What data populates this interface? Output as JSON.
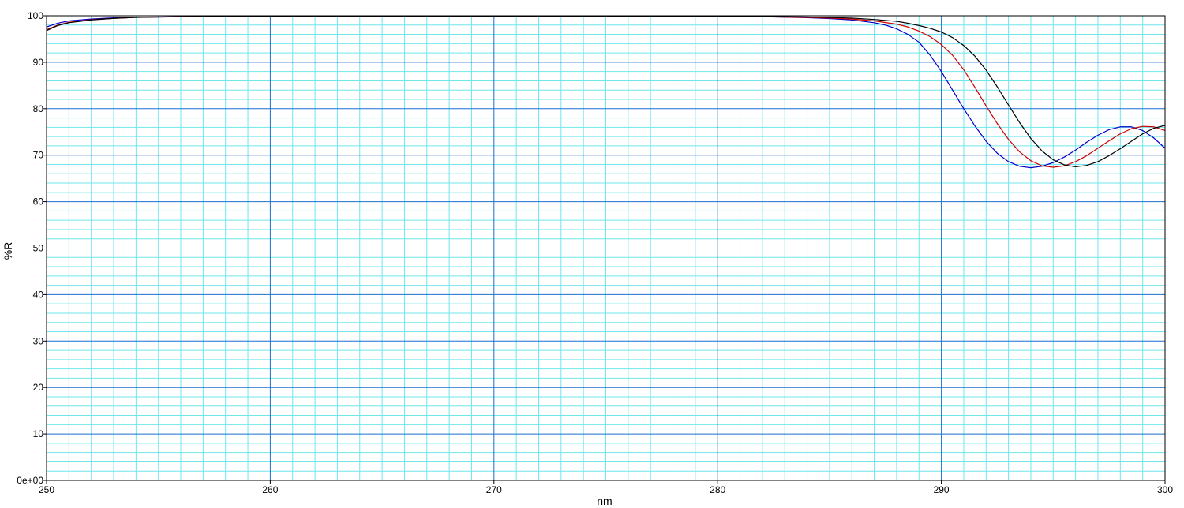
{
  "chart_data": {
    "type": "line",
    "title": "",
    "xlabel": "nm",
    "ylabel": "%R",
    "xlim": [
      250,
      300
    ],
    "ylim": [
      0,
      100
    ],
    "grid": true,
    "x_major_ticks": [
      "250",
      "260",
      "270",
      "280",
      "290",
      "300"
    ],
    "y_major_ticks": [
      "0e+00",
      "10",
      "20",
      "30",
      "40",
      "50",
      "60",
      "70",
      "80",
      "90",
      "100"
    ],
    "colors": {
      "major_grid": "#1a6fd0",
      "minor_grid": "#6fe6ee",
      "frame": "#000000",
      "series": [
        "#0000cc",
        "#cc0000",
        "#000000"
      ]
    },
    "series": [
      {
        "color": "#0000cc",
        "points": [
          [
            250,
            97.6
          ],
          [
            250.5,
            98.4
          ],
          [
            251,
            98.9
          ],
          [
            252,
            99.3
          ],
          [
            253,
            99.55
          ],
          [
            254,
            99.7
          ],
          [
            256,
            99.8
          ],
          [
            260,
            99.85
          ],
          [
            270,
            99.9
          ],
          [
            280,
            99.9
          ],
          [
            282,
            99.8
          ],
          [
            284,
            99.6
          ],
          [
            285,
            99.4
          ],
          [
            286,
            99.1
          ],
          [
            287,
            98.5
          ],
          [
            287.5,
            98
          ],
          [
            288,
            97.2
          ],
          [
            288.5,
            96
          ],
          [
            289,
            94.3
          ],
          [
            289.5,
            91.5
          ],
          [
            290,
            88
          ],
          [
            290.5,
            84
          ],
          [
            291,
            80
          ],
          [
            291.5,
            76.3
          ],
          [
            292,
            73
          ],
          [
            292.5,
            70.4
          ],
          [
            293,
            68.6
          ],
          [
            293.5,
            67.6
          ],
          [
            294,
            67.3
          ],
          [
            294.5,
            67.6
          ],
          [
            295,
            68.4
          ],
          [
            295.5,
            69.6
          ],
          [
            296,
            71.1
          ],
          [
            296.5,
            72.8
          ],
          [
            297,
            74.3
          ],
          [
            297.5,
            75.5
          ],
          [
            298,
            76.1
          ],
          [
            298.5,
            76.1
          ],
          [
            299,
            75.3
          ],
          [
            299.5,
            73.7
          ],
          [
            300,
            71.5
          ]
        ]
      },
      {
        "color": "#cc0000",
        "points": [
          [
            250,
            97
          ],
          [
            250.5,
            98
          ],
          [
            251,
            98.6
          ],
          [
            252,
            99.15
          ],
          [
            253,
            99.45
          ],
          [
            254,
            99.65
          ],
          [
            256,
            99.8
          ],
          [
            260,
            99.85
          ],
          [
            270,
            99.9
          ],
          [
            280,
            99.9
          ],
          [
            282,
            99.8
          ],
          [
            284,
            99.65
          ],
          [
            285,
            99.5
          ],
          [
            286,
            99.3
          ],
          [
            287,
            98.9
          ],
          [
            288,
            98.2
          ],
          [
            288.5,
            97.6
          ],
          [
            289,
            96.7
          ],
          [
            289.5,
            95.5
          ],
          [
            290,
            93.8
          ],
          [
            290.5,
            91.5
          ],
          [
            291,
            88.4
          ],
          [
            291.5,
            84.6
          ],
          [
            292,
            80.6
          ],
          [
            292.5,
            76.8
          ],
          [
            293,
            73.4
          ],
          [
            293.5,
            70.7
          ],
          [
            294,
            68.8
          ],
          [
            294.5,
            67.7
          ],
          [
            295,
            67.4
          ],
          [
            295.5,
            67.7
          ],
          [
            296,
            68.6
          ],
          [
            296.5,
            69.9
          ],
          [
            297,
            71.5
          ],
          [
            297.5,
            73.1
          ],
          [
            298,
            74.6
          ],
          [
            298.5,
            75.7
          ],
          [
            299,
            76.2
          ],
          [
            299.5,
            76.1
          ],
          [
            300,
            75.3
          ]
        ]
      },
      {
        "color": "#000000",
        "points": [
          [
            250,
            96.8
          ],
          [
            250.5,
            97.9
          ],
          [
            251,
            98.5
          ],
          [
            252,
            99.1
          ],
          [
            253,
            99.45
          ],
          [
            254,
            99.65
          ],
          [
            256,
            99.8
          ],
          [
            260,
            99.85
          ],
          [
            270,
            99.9
          ],
          [
            280,
            99.9
          ],
          [
            282,
            99.85
          ],
          [
            284,
            99.75
          ],
          [
            285,
            99.65
          ],
          [
            286,
            99.5
          ],
          [
            287,
            99.2
          ],
          [
            288,
            98.8
          ],
          [
            288.5,
            98.4
          ],
          [
            289,
            97.9
          ],
          [
            289.5,
            97.3
          ],
          [
            290,
            96.5
          ],
          [
            290.5,
            95.3
          ],
          [
            291,
            93.6
          ],
          [
            291.5,
            91.3
          ],
          [
            292,
            88.3
          ],
          [
            292.5,
            84.7
          ],
          [
            293,
            80.8
          ],
          [
            293.5,
            77
          ],
          [
            294,
            73.6
          ],
          [
            294.5,
            70.9
          ],
          [
            295,
            69
          ],
          [
            295.5,
            67.9
          ],
          [
            296,
            67.5
          ],
          [
            296.5,
            67.8
          ],
          [
            297,
            68.6
          ],
          [
            297.5,
            69.9
          ],
          [
            298,
            71.4
          ],
          [
            298.5,
            73
          ],
          [
            299,
            74.6
          ],
          [
            299.5,
            75.8
          ],
          [
            300,
            76.4
          ]
        ]
      }
    ]
  }
}
